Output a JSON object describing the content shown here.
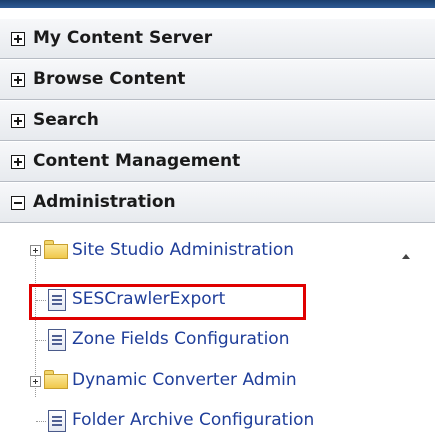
{
  "panels": [
    {
      "label": "My Content Server",
      "state": "collapsed"
    },
    {
      "label": "Browse Content",
      "state": "collapsed"
    },
    {
      "label": "Search",
      "state": "collapsed"
    },
    {
      "label": "Content Management",
      "state": "collapsed"
    },
    {
      "label": "Administration",
      "state": "expanded"
    }
  ],
  "tree": {
    "items": [
      {
        "label": "Site Studio Administration",
        "type": "folder",
        "expandable": true
      },
      {
        "label": "SESCrawlerExport",
        "type": "page",
        "highlighted": true
      },
      {
        "label": "Zone Fields Configuration",
        "type": "page"
      },
      {
        "label": "Dynamic Converter Admin",
        "type": "folder",
        "expandable": true
      },
      {
        "label": "Folder Archive Configuration",
        "type": "page"
      }
    ]
  },
  "colors": {
    "link": "#1f3e9a",
    "highlight_border": "#e00000",
    "top_bar": "#1b3f6e"
  }
}
